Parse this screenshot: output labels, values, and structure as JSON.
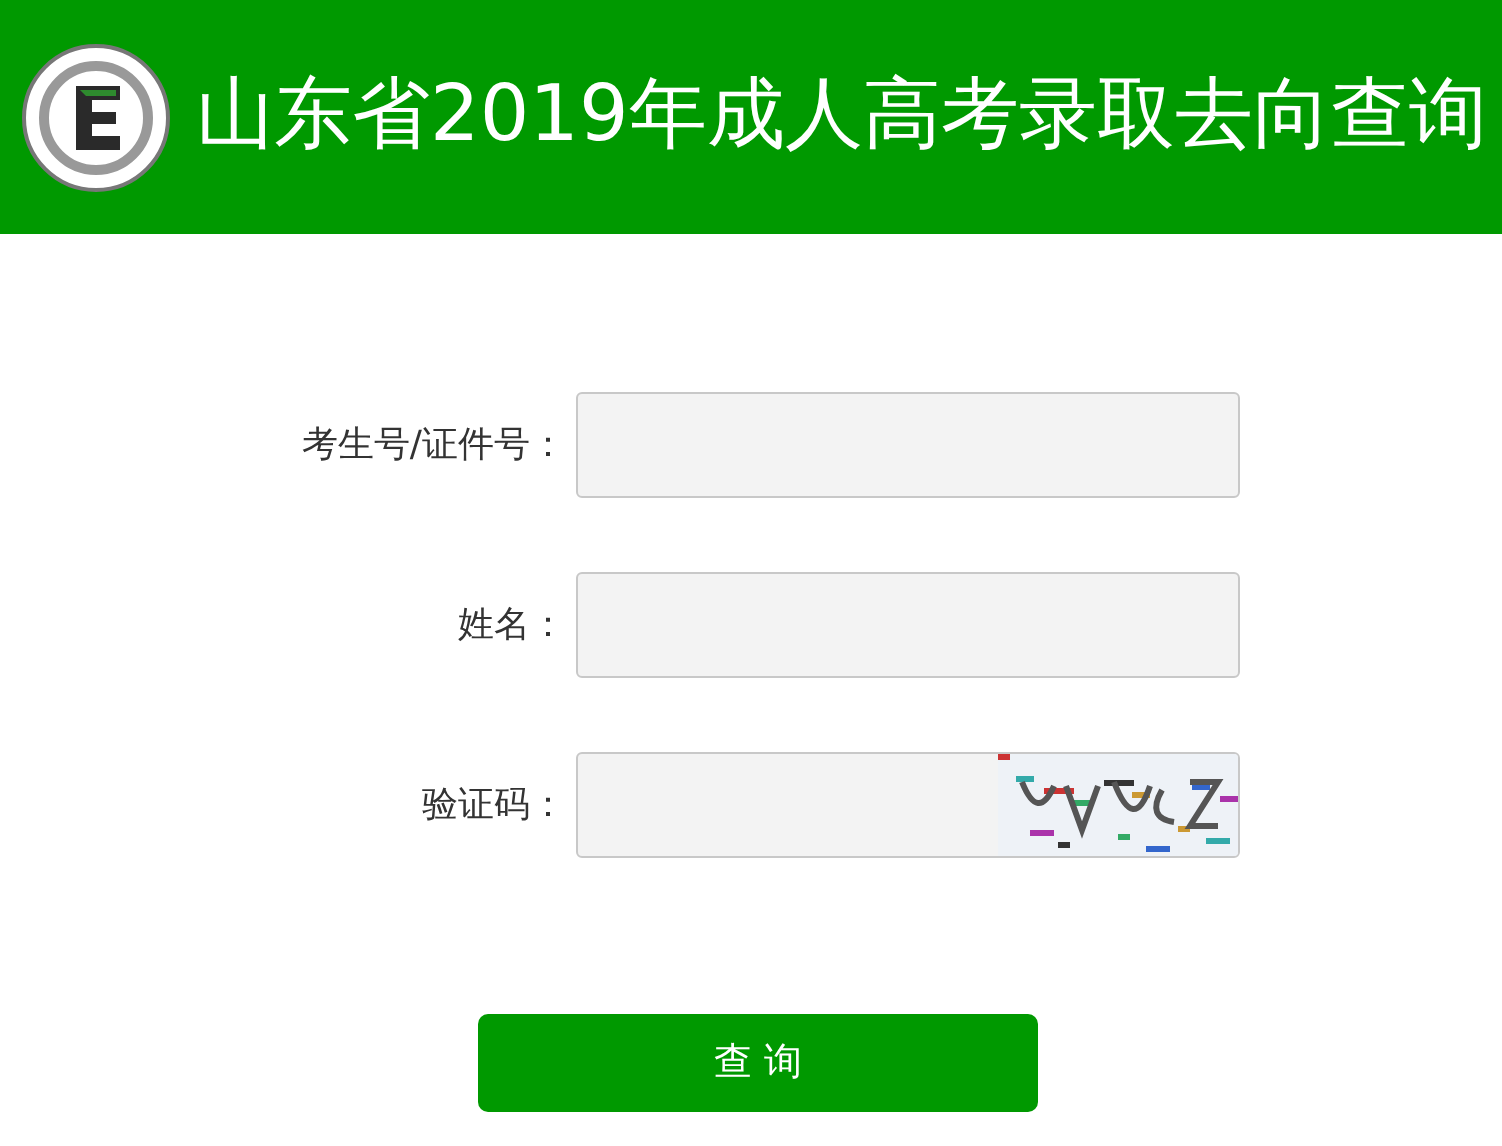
{
  "header": {
    "title": "山东省2019年成人高考录取去向查询"
  },
  "fields": [
    {
      "label": "考生号/证件号：",
      "kind": "text"
    },
    {
      "label": "姓名：",
      "kind": "text"
    },
    {
      "label": "验证码：",
      "kind": "captcha"
    }
  ],
  "submit": {
    "label": "查 询"
  }
}
